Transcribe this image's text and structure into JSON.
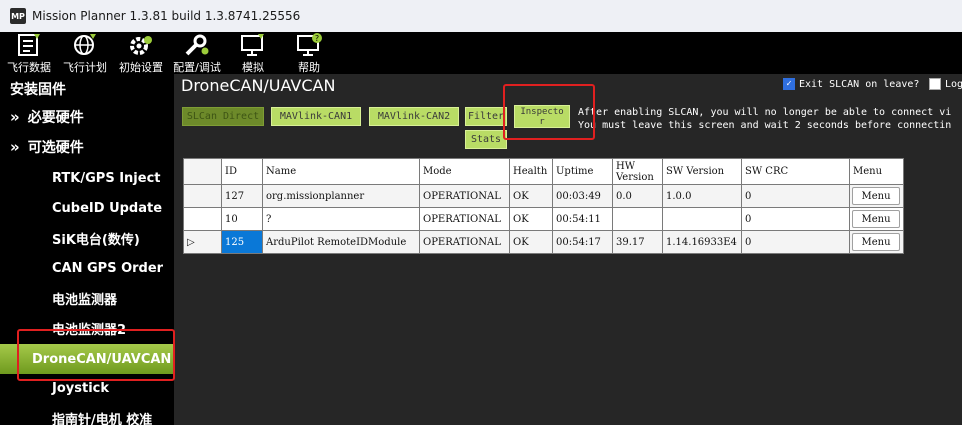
{
  "window": {
    "logo_text": "MP",
    "title": "Mission Planner 1.3.81 build 1.3.8741.25556"
  },
  "toolbar": [
    {
      "icon": "flight-data-icon",
      "label": "飞行数据"
    },
    {
      "icon": "flight-plan-icon",
      "label": "飞行计划"
    },
    {
      "icon": "initial-setup-icon",
      "label": "初始设置"
    },
    {
      "icon": "config-tuning-icon",
      "label": "配置/调试"
    },
    {
      "icon": "simulation-icon",
      "label": "模拟"
    },
    {
      "icon": "help-icon",
      "label": "帮助"
    }
  ],
  "sidebar": {
    "header": "安装固件",
    "groups": [
      {
        "arrow": "»",
        "label": "必要硬件"
      },
      {
        "arrow": "»",
        "label": "可选硬件"
      }
    ],
    "items": [
      "RTK/GPS Inject",
      "CubeID Update",
      "SiK电台(数传)",
      "CAN GPS Order",
      "电池监测器",
      "电池监测器2",
      "DroneCAN/UAVCAN",
      "Joystick",
      "指南针/电机 校准"
    ],
    "active_index": 6
  },
  "main": {
    "title": "DroneCAN/UAVCAN",
    "options": {
      "exit_slcan": {
        "label": "Exit SLCAN on leave?",
        "checked": true
      },
      "log": {
        "label": "Log",
        "checked": false
      }
    },
    "buttons": {
      "slcan_direct": "SLCan Direct",
      "mavlink_can1": "MAVlink-CAN1",
      "mavlink_can2": "MAVlink-CAN2",
      "filter": "Filter",
      "stats": "Stats",
      "inspector": "Inspecto r"
    },
    "info_lines": [
      "After enabling SLCAN, you will no longer be able to connect vi",
      "You must leave this screen and wait 2 seconds before connectin"
    ]
  },
  "table": {
    "columns": [
      "ID",
      "Name",
      "Mode",
      "Health",
      "Uptime",
      "HW Version",
      "SW Version",
      "SW CRC",
      "Menu"
    ],
    "rows": [
      {
        "marker": "",
        "id": "127",
        "name": "org.missionplanner",
        "mode": "OPERATIONAL",
        "health": "OK",
        "uptime": "00:03:49",
        "hw": "0.0",
        "sw": "1.0.0",
        "crc": "0",
        "menu": "Menu"
      },
      {
        "marker": "",
        "id": "10",
        "name": "?",
        "mode": "OPERATIONAL",
        "health": "OK",
        "uptime": "00:54:11",
        "hw": "",
        "sw": "",
        "crc": "0",
        "menu": "Menu"
      },
      {
        "marker": "▷",
        "id": "125",
        "name": "ArduPilot RemoteIDModule",
        "mode": "OPERATIONAL",
        "health": "OK",
        "uptime": "00:54:17",
        "hw": "39.17",
        "sw": "1.14.16933E4",
        "crc": "0",
        "menu": "Menu"
      }
    ]
  },
  "colors": {
    "accent_green": "#b9dc65",
    "highlight_red": "#e02020",
    "selected_blue": "#0a78d7"
  }
}
